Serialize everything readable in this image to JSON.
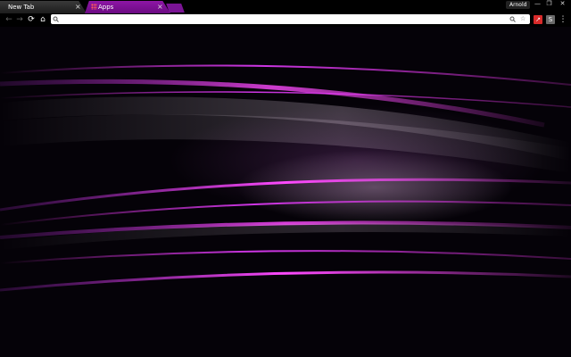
{
  "tabs": [
    {
      "label": "New Tab",
      "close": "×"
    },
    {
      "label": "Apps",
      "close": "×"
    }
  ],
  "profile_name": "Arnold",
  "window_controls": {
    "minimize": "—",
    "restore": "❐",
    "close": "✕"
  },
  "toolbar": {
    "back": "←",
    "forward": "→",
    "reload": "⟳",
    "home": "⌂",
    "menu": "⋮"
  },
  "omnibox": {
    "value": "",
    "placeholder": ""
  },
  "extensions": [
    {
      "name": "red-extension",
      "glyph": "↗",
      "color": "#d92a2a"
    },
    {
      "name": "gray-extension",
      "glyph": "S",
      "color": "#6a6a6a"
    }
  ],
  "theme": {
    "accent": "#8e16a6",
    "background": "#000000"
  }
}
